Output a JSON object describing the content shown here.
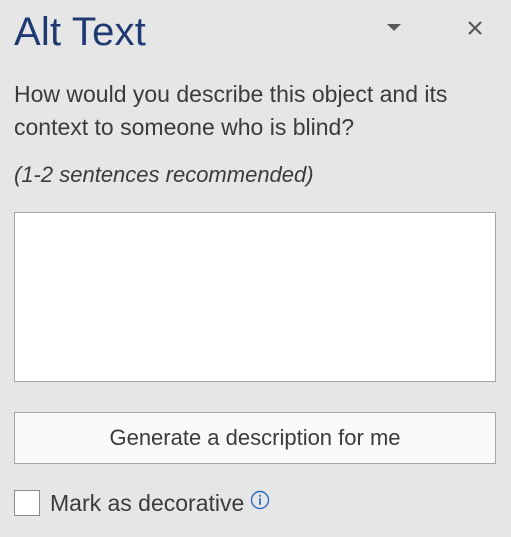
{
  "pane": {
    "title": "Alt Text",
    "dropdown_icon": "chevron-down-icon",
    "close_icon": "close-icon"
  },
  "prompt": {
    "question": "How would you describe this object and its context to someone who is blind?",
    "hint": "(1-2 sentences recommended)"
  },
  "description": {
    "value": "",
    "placeholder": ""
  },
  "generate_button": {
    "label": "Generate a description for me"
  },
  "decorative": {
    "label": "Mark as decorative",
    "checked": false,
    "info_icon": "info-icon"
  },
  "colors": {
    "title": "#1f3a73",
    "pane_background": "#e6e6e6",
    "info_icon": "#2b6cc4"
  }
}
